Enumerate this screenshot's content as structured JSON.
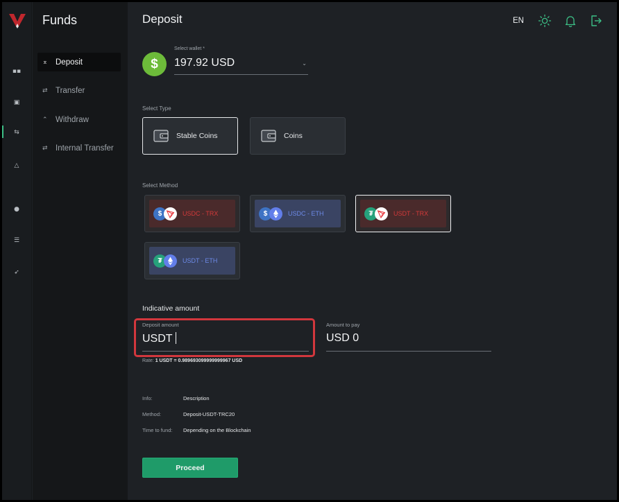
{
  "sidebar": {
    "title": "Funds",
    "items": [
      {
        "label": "Deposit",
        "icon": "upload-icon",
        "active": true
      },
      {
        "label": "Transfer",
        "icon": "swap-icon",
        "active": false
      },
      {
        "label": "Withdraw",
        "icon": "download-icon",
        "active": false
      },
      {
        "label": "Internal Transfer",
        "icon": "swap-icon",
        "active": false
      }
    ]
  },
  "header": {
    "title": "Deposit",
    "language": "EN"
  },
  "wallet": {
    "label": "Select wallet *",
    "value": "197.92 USD",
    "icon": "$"
  },
  "select_type": {
    "label": "Select Type",
    "options": [
      {
        "label": "Stable Coins",
        "selected": true
      },
      {
        "label": "Coins",
        "selected": false
      }
    ]
  },
  "select_method": {
    "label": "Select Method",
    "options": [
      {
        "label": "USDC - TRX",
        "selected": false
      },
      {
        "label": "USDC - ETH",
        "selected": false
      },
      {
        "label": "USDT - TRX",
        "selected": true
      },
      {
        "label": "USDT - ETH",
        "selected": false
      }
    ]
  },
  "amount": {
    "title": "Indicative amount",
    "deposit_label": "Deposit amount",
    "deposit_value": "USDT",
    "pay_label": "Amount to pay",
    "pay_value": "USD 0",
    "rate_prefix": "Rate:",
    "rate_value": "1 USDT = 0.989693099999999967 USD"
  },
  "info": {
    "rows": [
      {
        "key": "Info:",
        "value": "Description"
      },
      {
        "key": "Method:",
        "value": "Deposit-USDT-TRC20"
      },
      {
        "key": "Time to fund:",
        "value": "Depending on the Blockchain"
      }
    ]
  },
  "proceed_label": "Proceed",
  "colors": {
    "accent": "#1f9b69",
    "highlight": "#d2373d",
    "wallet": "#6dbb3a"
  }
}
